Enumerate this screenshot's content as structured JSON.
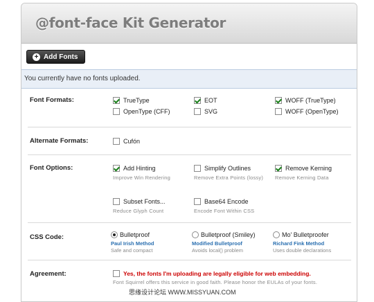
{
  "page": {
    "title": "@font-face Kit Generator",
    "add_button": "Add Fonts",
    "notice": "You currently have no fonts uploaded."
  },
  "rows": {
    "formats": {
      "label": "Font Formats:",
      "options": [
        {
          "label": "TrueType",
          "checked": true
        },
        {
          "label": "EOT",
          "checked": true
        },
        {
          "label": "WOFF (TrueType)",
          "checked": true
        },
        {
          "label": "OpenType (CFF)",
          "checked": false
        },
        {
          "label": "SVG",
          "checked": false
        },
        {
          "label": "WOFF (OpenType)",
          "checked": false
        }
      ]
    },
    "alternate": {
      "label": "Alternate Formats:",
      "options": [
        {
          "label": "Cufón",
          "checked": false
        }
      ]
    },
    "font_options": {
      "label": "Font Options:",
      "options": [
        {
          "label": "Add Hinting",
          "hint": "Improve Win Rendering",
          "checked": true
        },
        {
          "label": "Simplify Outlines",
          "hint": "Remove Extra Points (lossy)",
          "checked": false
        },
        {
          "label": "Remove Kerning",
          "hint": "Remove Kerning Data",
          "checked": true
        },
        {
          "label": "Subset Fonts...",
          "hint": "Reduce Glyph Count",
          "checked": false
        },
        {
          "label": "Base64 Encode",
          "hint": "Encode Font Within CSS",
          "checked": false
        }
      ]
    },
    "css": {
      "label": "CSS Code:",
      "options": [
        {
          "label": "Bulletproof",
          "link": "Paul Irish Method",
          "sub": "Safe and compact",
          "selected": true
        },
        {
          "label": "Bulletproof (Smiley)",
          "link": "Modified Bulletproof",
          "sub": "Avoids local() problem",
          "selected": false
        },
        {
          "label": "Mo' Bulletproofer",
          "link": "Richard Fink Method",
          "sub": "Uses double declarations",
          "selected": false
        }
      ]
    },
    "agreement": {
      "label": "Agreement:",
      "text": "Yes, the fonts I'm uploading are legally eligible for web embedding.",
      "note": "Font Squirrel offers this service in good faith. Please honor the EULAs of your fonts.",
      "checked": false
    }
  },
  "watermark": "思缘设计论坛 WWW.MISSYUAN.COM"
}
